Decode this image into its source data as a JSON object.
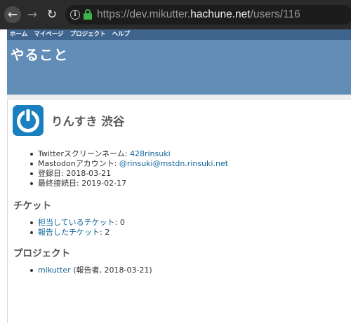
{
  "browser": {
    "url_prefix": "https://dev.mikutter.",
    "url_host": "hachune.net",
    "url_path": "/users/116",
    "back_glyph": "←",
    "forward_glyph": "→",
    "reload_glyph": "↻",
    "info_glyph": "i"
  },
  "top_menu": {
    "home": "ホーム",
    "my_page": "マイページ",
    "projects": "プロジェクト",
    "help": "ヘルプ"
  },
  "header": {
    "title": "やること"
  },
  "user": {
    "avatar_color": "#1a7fbe",
    "name": "りんすき 渋谷",
    "details": [
      {
        "label": "Twitterスクリーンネーム: ",
        "value": "428rinsuki",
        "is_link": true
      },
      {
        "label": "Mastodonアカウント: ",
        "value": "@rinsuki@mstdn.rinsuki.net",
        "is_link": true
      },
      {
        "label": "登録日: ",
        "value": "2018-03-21",
        "is_link": false
      },
      {
        "label": "最終接続日: ",
        "value": "2019-02-17",
        "is_link": false
      }
    ]
  },
  "tickets": {
    "heading": "チケット",
    "items": [
      {
        "link": "担当しているチケット",
        "value": ": 0"
      },
      {
        "link": "報告したチケット",
        "value": ": 2"
      }
    ]
  },
  "projects": {
    "heading": "プロジェクト",
    "items": [
      {
        "link": "mikutter",
        "value": " (報告者, 2018-03-21)"
      }
    ]
  },
  "colors": {
    "header_bg": "#628db6",
    "top_bar_bg": "#3f658f",
    "link": "#116699",
    "lock": "#3cb64a"
  }
}
